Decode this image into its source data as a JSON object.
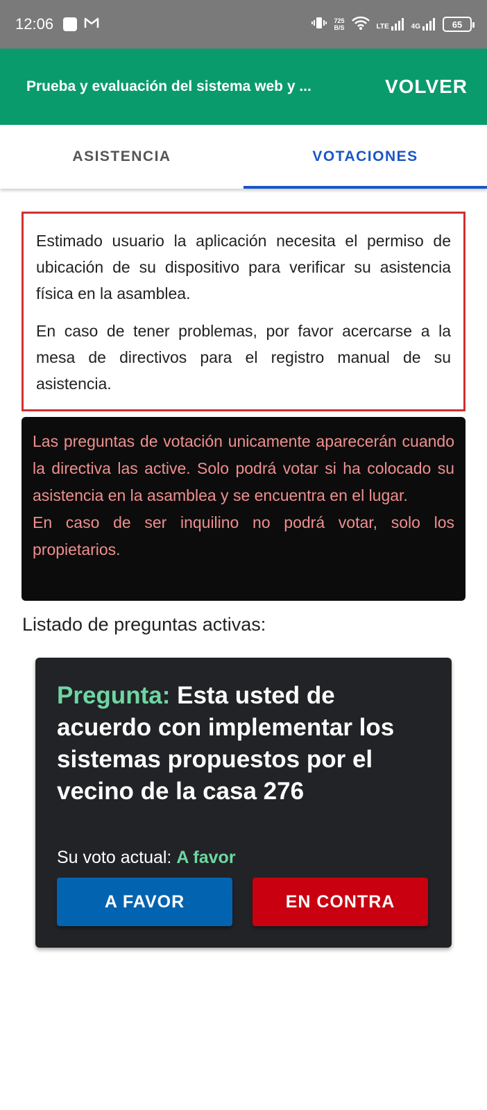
{
  "status_bar": {
    "time": "12:06",
    "net_speed_value": "725",
    "net_speed_unit": "B/S",
    "lte_label": "LTE",
    "fourg_label": "4G",
    "battery": "65"
  },
  "app_bar": {
    "title": "Prueba y evaluación del sistema web y ...",
    "back_label": "VOLVER",
    "color": "#0a9b6c"
  },
  "tabs": [
    {
      "label": "ASISTENCIA",
      "active": false
    },
    {
      "label": "VOTACIONES",
      "active": true
    }
  ],
  "notice": {
    "paragraph_1": "Estimado usuario la aplicación necesita el permiso de ubicación de su dispositivo para verificar su asistencia física en la asamblea.",
    "paragraph_2": "En caso de tener problemas, por favor acercarse a la mesa de directivos para el registro manual de su asistencia."
  },
  "info": {
    "line_1": "Las preguntas de votación unicamente aparecerán cuando la directiva las active. Solo podrá votar si ha colocado su asistencia en la asamblea y se encuentra en el lugar.",
    "line_2": "En caso de ser inquilino no podrá votar, solo los propietarios."
  },
  "list_heading": "Listado de preguntas activas:",
  "question_card": {
    "label": "Pregunta:",
    "text": "Esta usted de acuerdo con implementar los sistemas propuestos por el vecino de la casa 276",
    "current_vote_label": "Su voto actual:",
    "current_vote_value": "A favor",
    "favor_button": "A FAVOR",
    "contra_button": "EN CONTRA",
    "favor_color": "#0263b0",
    "contra_color": "#c8000f"
  }
}
